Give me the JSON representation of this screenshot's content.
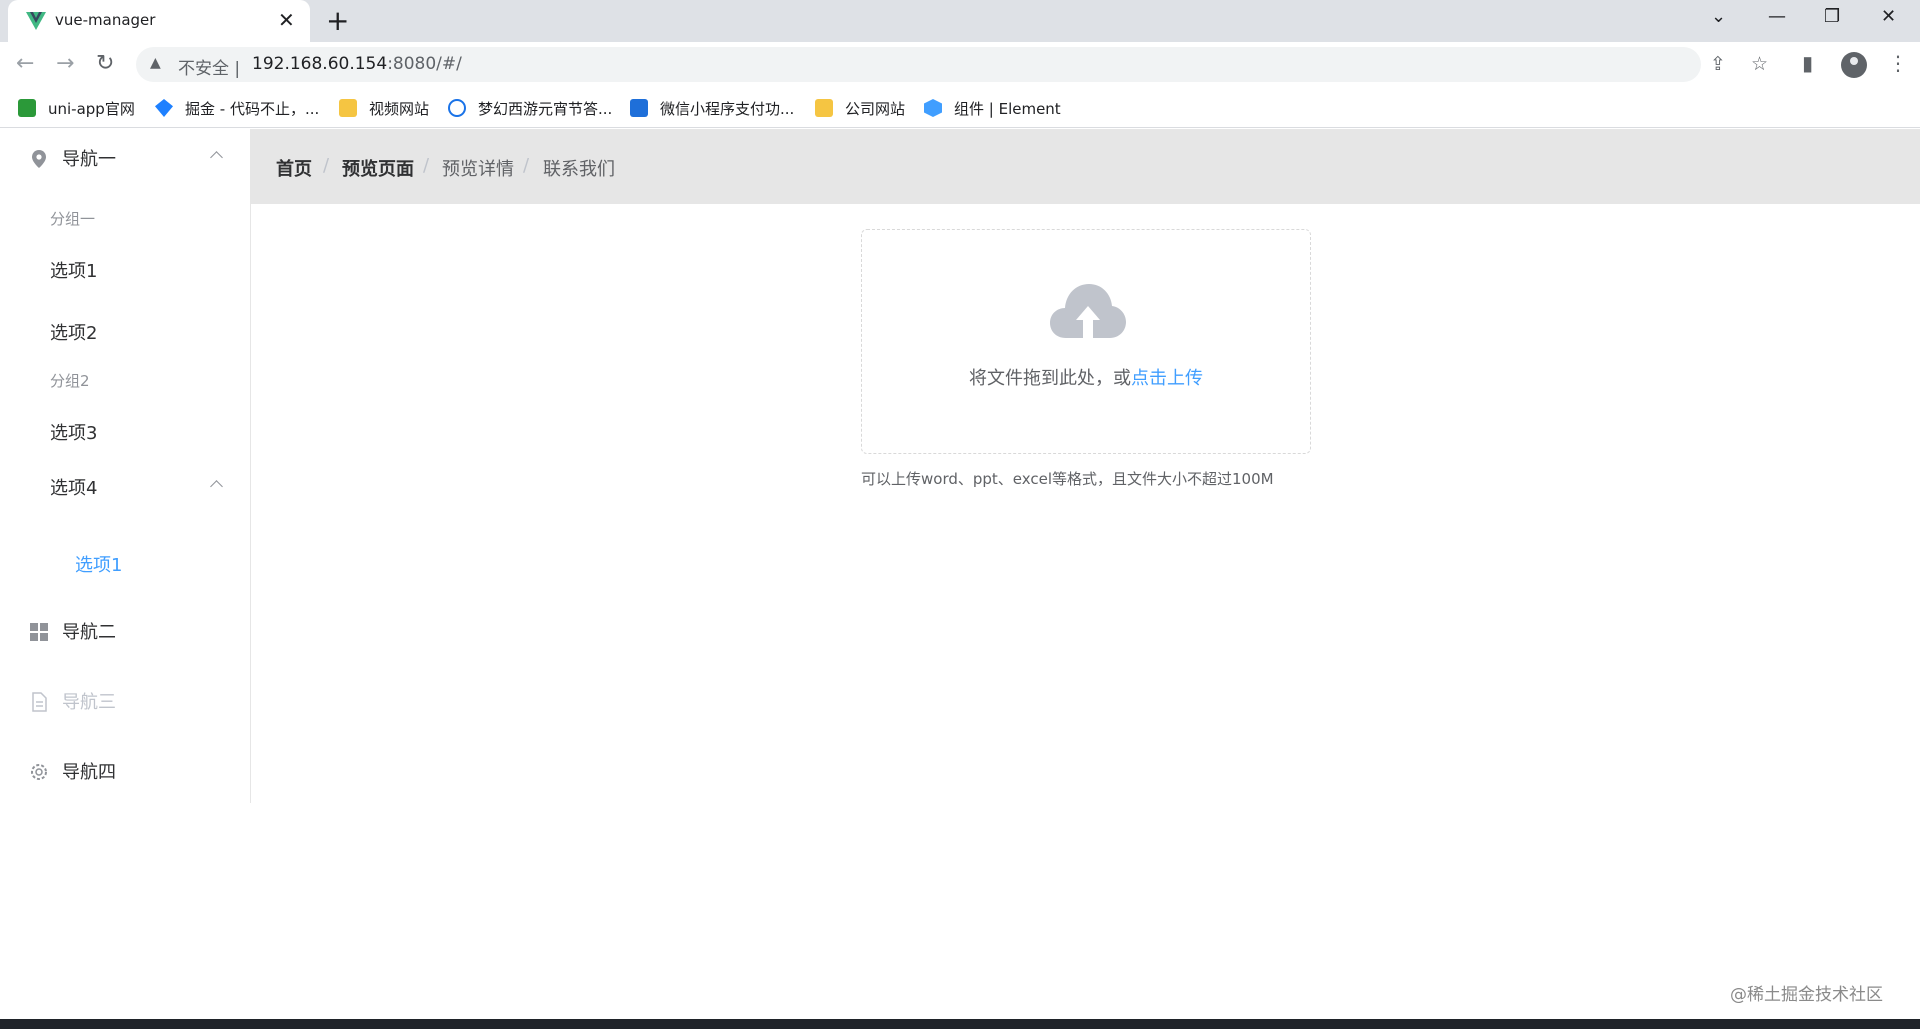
{
  "browser": {
    "tab_title": "vue-manager",
    "insecure_label": "不安全",
    "url_host": "192.168.60.154",
    "url_rest": ":8080/#/",
    "bookmarks": [
      {
        "label": "uni-app官网",
        "color": "#2b9939"
      },
      {
        "label": "掘金 - 代码不止，...",
        "color": "#1e80ff"
      },
      {
        "label": "视频网站",
        "color": "#f5c542"
      },
      {
        "label": "梦幻西游元宵节答...",
        "color": "#1a73e8"
      },
      {
        "label": "微信小程序支付功...",
        "color": "#1e6fd9"
      },
      {
        "label": "公司网站",
        "color": "#f5c542"
      },
      {
        "label": "组件 | Element",
        "color": "#409eff"
      }
    ]
  },
  "sidebar": {
    "nav1": {
      "label": "导航一",
      "icon": "location-icon"
    },
    "group1": "分组一",
    "option1": "选项1",
    "option2": "选项2",
    "group2": "分组2",
    "option3": "选项3",
    "option4": "选项4",
    "option4_sub1": "选项1",
    "nav2": {
      "label": "导航二",
      "icon": "grid-icon"
    },
    "nav3": {
      "label": "导航三",
      "icon": "document-icon"
    },
    "nav4": {
      "label": "导航四",
      "icon": "gear-icon"
    }
  },
  "breadcrumb": [
    "首页",
    "预览页面",
    "预览详情",
    "联系我们"
  ],
  "breadcrumb_separator": "/",
  "upload": {
    "text": "将文件拖到此处，或",
    "link": "点击上传",
    "tip": "可以上传word、ppt、excel等格式，且文件大小不超过100M"
  },
  "watermark": "@稀土掘金技术社区",
  "colors": {
    "accent": "#409eff",
    "breadcrumb_bg": "#e6e6e6"
  }
}
